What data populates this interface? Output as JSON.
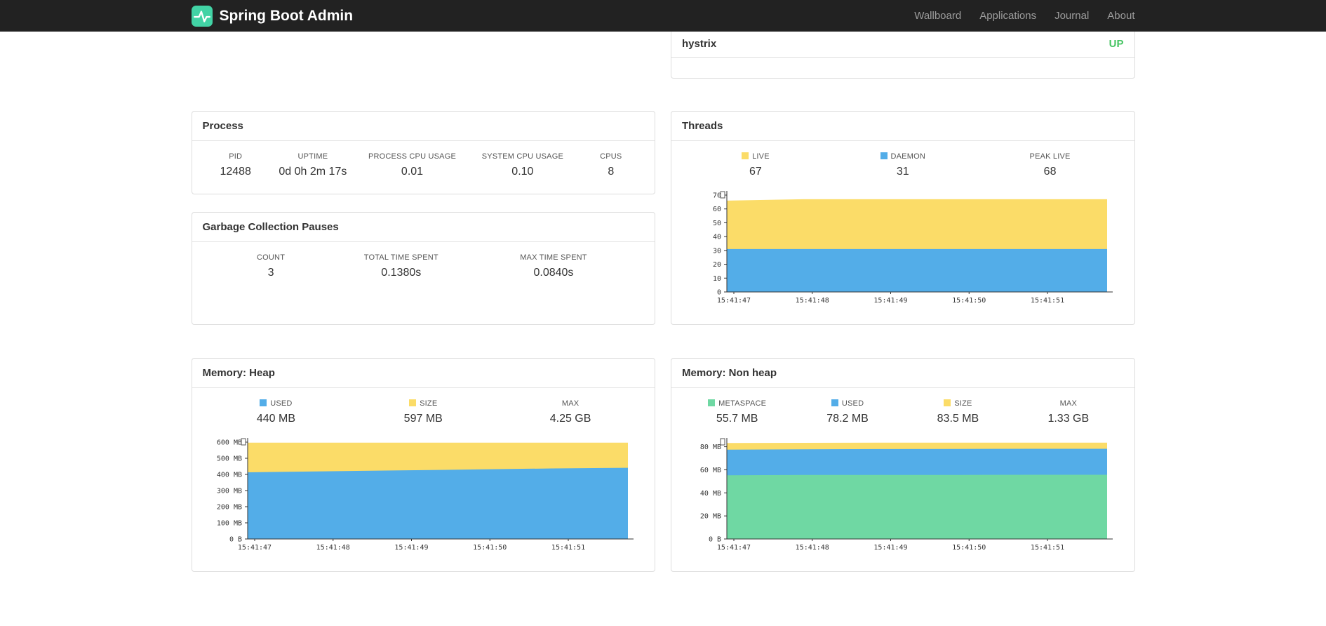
{
  "navbar": {
    "brand": "Spring Boot Admin",
    "links": [
      {
        "label": "Wallboard"
      },
      {
        "label": "Applications"
      },
      {
        "label": "Journal"
      },
      {
        "label": "About"
      }
    ]
  },
  "colors": {
    "navbar_bg": "#222222",
    "brand_teal": "#42d3a5",
    "up_green": "#45c462",
    "blue": "#53ade8",
    "yellow": "#fbdc68",
    "green": "#6fd8a3",
    "border": "#dddddd"
  },
  "applications_panel": {
    "app_name": "hystrix",
    "status": "UP"
  },
  "process": {
    "title": "Process",
    "stats": [
      {
        "label": "PID",
        "value": "12488"
      },
      {
        "label": "UPTIME",
        "value": "0d 0h 2m 17s"
      },
      {
        "label": "PROCESS CPU USAGE",
        "value": "0.01"
      },
      {
        "label": "SYSTEM CPU USAGE",
        "value": "0.10"
      },
      {
        "label": "CPUS",
        "value": "8"
      }
    ]
  },
  "gc": {
    "title": "Garbage Collection Pauses",
    "stats": [
      {
        "label": "COUNT",
        "value": "3"
      },
      {
        "label": "TOTAL TIME SPENT",
        "value": "0.1380s"
      },
      {
        "label": "MAX TIME SPENT",
        "value": "0.0840s"
      }
    ]
  },
  "threads": {
    "title": "Threads",
    "legend": [
      {
        "label": "LIVE",
        "value": "67"
      },
      {
        "label": "DAEMON",
        "value": "31"
      },
      {
        "label": "PEAK LIVE",
        "value": "68"
      }
    ]
  },
  "heap": {
    "title": "Memory: Heap",
    "legend": [
      {
        "label": "USED",
        "value": "440 MB"
      },
      {
        "label": "SIZE",
        "value": "597 MB"
      },
      {
        "label": "MAX",
        "value": "4.25 GB"
      }
    ]
  },
  "nonheap": {
    "title": "Memory: Non heap",
    "legend": [
      {
        "label": "METASPACE",
        "value": "55.7 MB"
      },
      {
        "label": "USED",
        "value": "78.2 MB"
      },
      {
        "label": "SIZE",
        "value": "83.5 MB"
      },
      {
        "label": "MAX",
        "value": "1.33 GB"
      }
    ]
  },
  "chart_data": [
    {
      "id": "threads",
      "type": "area",
      "title": "Threads",
      "stacked": true,
      "x_labels": [
        "15:41:47",
        "15:41:48",
        "15:41:49",
        "15:41:50",
        "15:41:51"
      ],
      "ylim": [
        0,
        70
      ],
      "yticks": [
        {
          "v": 0,
          "label": "0"
        },
        {
          "v": 10,
          "label": "10"
        },
        {
          "v": 20,
          "label": "20"
        },
        {
          "v": 30,
          "label": "30"
        },
        {
          "v": 40,
          "label": "40"
        },
        {
          "v": 50,
          "label": "50"
        },
        {
          "v": 60,
          "label": "60"
        },
        {
          "v": 70,
          "label": "70"
        }
      ],
      "series": [
        {
          "name": "LIVE",
          "color": "yellow",
          "values": [
            66,
            67,
            67,
            67,
            67,
            67
          ]
        },
        {
          "name": "DAEMON",
          "color": "blue",
          "values": [
            31,
            31,
            31,
            31,
            31,
            31
          ]
        }
      ]
    },
    {
      "id": "heap",
      "type": "area",
      "title": "Memory: Heap (MB)",
      "stacked": true,
      "x_labels": [
        "15:41:47",
        "15:41:48",
        "15:41:49",
        "15:41:50",
        "15:41:51"
      ],
      "ylim": [
        0,
        600
      ],
      "yticks": [
        {
          "v": 0,
          "label": "0 B"
        },
        {
          "v": 100,
          "label": "100 MB"
        },
        {
          "v": 200,
          "label": "200 MB"
        },
        {
          "v": 300,
          "label": "300 MB"
        },
        {
          "v": 400,
          "label": "400 MB"
        },
        {
          "v": 500,
          "label": "500 MB"
        },
        {
          "v": 600,
          "label": "600 MB"
        }
      ],
      "series": [
        {
          "name": "SIZE",
          "color": "yellow",
          "values": [
            597,
            597,
            597,
            597,
            597,
            597
          ]
        },
        {
          "name": "USED",
          "color": "blue",
          "values": [
            413,
            419,
            425,
            431,
            437,
            441
          ]
        }
      ]
    },
    {
      "id": "nonheap",
      "type": "area",
      "title": "Memory: Non heap (MB)",
      "stacked": true,
      "x_labels": [
        "15:41:47",
        "15:41:48",
        "15:41:49",
        "15:41:50",
        "15:41:51"
      ],
      "ylim": [
        0,
        84
      ],
      "yticks": [
        {
          "v": 0,
          "label": "0 B"
        },
        {
          "v": 20,
          "label": "20 MB"
        },
        {
          "v": 40,
          "label": "40 MB"
        },
        {
          "v": 60,
          "label": "60 MB"
        },
        {
          "v": 80,
          "label": "80 MB"
        }
      ],
      "series": [
        {
          "name": "SIZE",
          "color": "yellow",
          "values": [
            83.3,
            83.4,
            83.5,
            83.5,
            83.5,
            83.5
          ]
        },
        {
          "name": "USED",
          "color": "blue",
          "values": [
            77.4,
            77.8,
            78.0,
            78.1,
            78.2,
            78.2
          ]
        },
        {
          "name": "METASPACE",
          "color": "green",
          "values": [
            55.3,
            55.5,
            55.6,
            55.6,
            55.7,
            55.7
          ]
        }
      ]
    }
  ]
}
